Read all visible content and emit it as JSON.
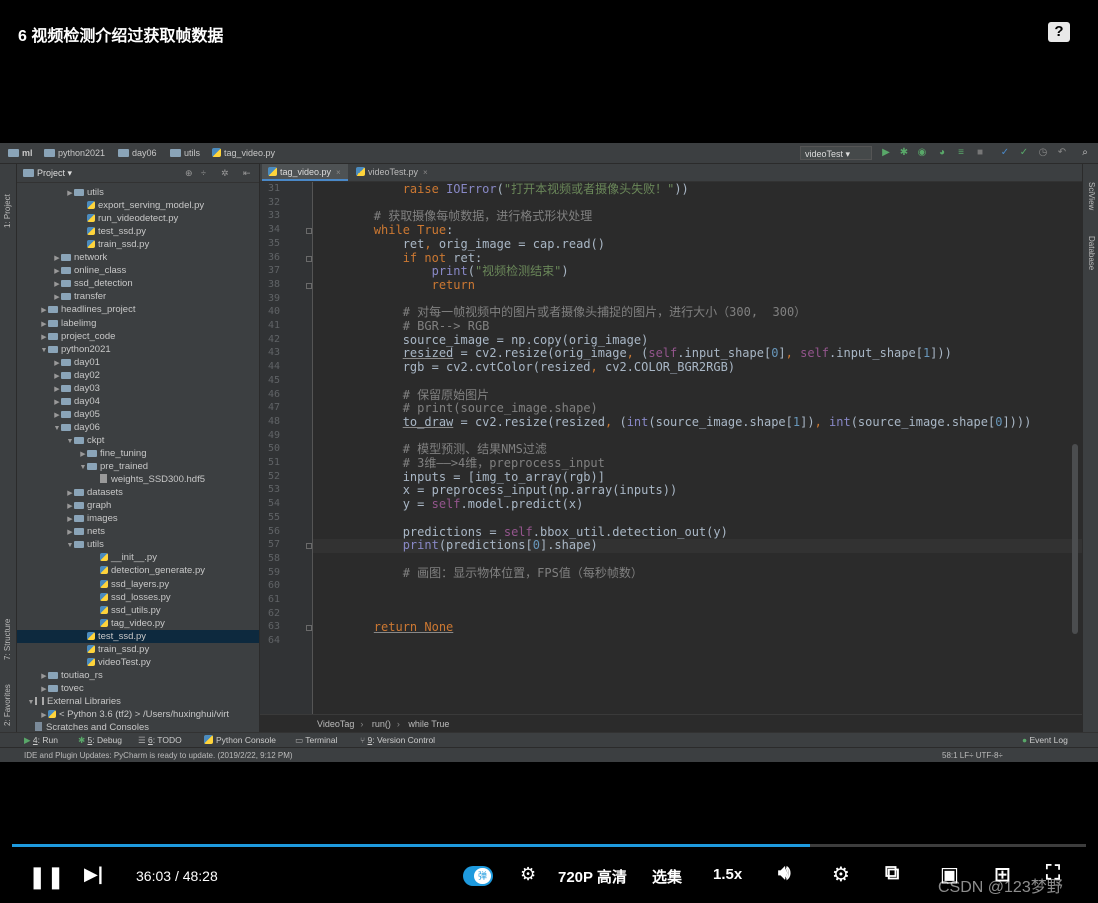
{
  "video": {
    "title": "6 视频检测介绍过获取帧数据",
    "help_icon": "?",
    "current_time": "36:03",
    "time_sep": "/",
    "total_time": "48:28",
    "progress": 0.743,
    "danmu_label": "弹",
    "quality": "720P 高清",
    "episodes": "选集",
    "speed": "1.5x",
    "watermark": "CSDN @123梦野"
  },
  "ide": {
    "breadcrumbs": [
      "ml",
      "python2021",
      "day06",
      "utils",
      "tag_video.py"
    ],
    "run_config": "videoTest",
    "left_tool_tabs": [
      "1: Project",
      "7: Structure",
      "2: Favorites"
    ],
    "right_tool_tabs": [
      "SciView",
      "Database"
    ],
    "project_header": "Project",
    "tree": [
      {
        "label": "utils",
        "type": "folder",
        "depth": 3,
        "arrow": "▶"
      },
      {
        "label": "export_serving_model.py",
        "type": "py",
        "depth": 4,
        "arrow": ""
      },
      {
        "label": "run_videodetect.py",
        "type": "py",
        "depth": 4,
        "arrow": ""
      },
      {
        "label": "test_ssd.py",
        "type": "py",
        "depth": 4,
        "arrow": ""
      },
      {
        "label": "train_ssd.py",
        "type": "py",
        "depth": 4,
        "arrow": ""
      },
      {
        "label": "network",
        "type": "folder",
        "depth": 2,
        "arrow": "▶"
      },
      {
        "label": "online_class",
        "type": "folder",
        "depth": 2,
        "arrow": "▶"
      },
      {
        "label": "ssd_detection",
        "type": "folder",
        "depth": 2,
        "arrow": "▶"
      },
      {
        "label": "transfer",
        "type": "folder",
        "depth": 2,
        "arrow": "▶"
      },
      {
        "label": "headlines_project",
        "type": "folder",
        "depth": 1,
        "arrow": "▶"
      },
      {
        "label": "labelimg",
        "type": "folder",
        "depth": 1,
        "arrow": "▶"
      },
      {
        "label": "project_code",
        "type": "folder",
        "depth": 1,
        "arrow": "▶"
      },
      {
        "label": "python2021",
        "type": "folder",
        "depth": 1,
        "arrow": "▼"
      },
      {
        "label": "day01",
        "type": "folder",
        "depth": 2,
        "arrow": "▶"
      },
      {
        "label": "day02",
        "type": "folder",
        "depth": 2,
        "arrow": "▶"
      },
      {
        "label": "day03",
        "type": "folder",
        "depth": 2,
        "arrow": "▶"
      },
      {
        "label": "day04",
        "type": "folder",
        "depth": 2,
        "arrow": "▶"
      },
      {
        "label": "day05",
        "type": "folder",
        "depth": 2,
        "arrow": "▶"
      },
      {
        "label": "day06",
        "type": "folder",
        "depth": 2,
        "arrow": "▼"
      },
      {
        "label": "ckpt",
        "type": "folder",
        "depth": 3,
        "arrow": "▼"
      },
      {
        "label": "fine_tuning",
        "type": "folder",
        "depth": 4,
        "arrow": "▶"
      },
      {
        "label": "pre_trained",
        "type": "folder",
        "depth": 4,
        "arrow": "▼"
      },
      {
        "label": "weights_SSD300.hdf5",
        "type": "file",
        "depth": 5,
        "arrow": ""
      },
      {
        "label": "datasets",
        "type": "folder",
        "depth": 3,
        "arrow": "▶"
      },
      {
        "label": "graph",
        "type": "folder",
        "depth": 3,
        "arrow": "▶"
      },
      {
        "label": "images",
        "type": "folder",
        "depth": 3,
        "arrow": "▶"
      },
      {
        "label": "nets",
        "type": "folder",
        "depth": 3,
        "arrow": "▶"
      },
      {
        "label": "utils",
        "type": "folder",
        "depth": 3,
        "arrow": "▼"
      },
      {
        "label": "__init__.py",
        "type": "py",
        "depth": 5,
        "arrow": ""
      },
      {
        "label": "detection_generate.py",
        "type": "py",
        "depth": 5,
        "arrow": ""
      },
      {
        "label": "ssd_layers.py",
        "type": "py",
        "depth": 5,
        "arrow": ""
      },
      {
        "label": "ssd_losses.py",
        "type": "py",
        "depth": 5,
        "arrow": ""
      },
      {
        "label": "ssd_utils.py",
        "type": "py",
        "depth": 5,
        "arrow": ""
      },
      {
        "label": "tag_video.py",
        "type": "py",
        "depth": 5,
        "arrow": ""
      },
      {
        "label": "test_ssd.py",
        "type": "py",
        "depth": 4,
        "arrow": "",
        "selected": true
      },
      {
        "label": "train_ssd.py",
        "type": "py",
        "depth": 4,
        "arrow": ""
      },
      {
        "label": "videoTest.py",
        "type": "py",
        "depth": 4,
        "arrow": ""
      },
      {
        "label": "toutiao_rs",
        "type": "folder",
        "depth": 1,
        "arrow": "▶"
      },
      {
        "label": "tovec",
        "type": "folder",
        "depth": 1,
        "arrow": "▶"
      },
      {
        "label": "External Libraries",
        "type": "lib",
        "depth": 0,
        "arrow": "▼"
      },
      {
        "label": "< Python 3.6 (tf2) >  /Users/huxinghui/virt",
        "type": "pyenv",
        "depth": 1,
        "arrow": "▶"
      },
      {
        "label": "Scratches and Consoles",
        "type": "scratch",
        "depth": 0,
        "arrow": ""
      }
    ],
    "tabs": [
      {
        "label": "tag_video.py",
        "active": true
      },
      {
        "label": "videoTest.py",
        "active": false
      }
    ],
    "line_numbers": [
      "31",
      "32",
      "33",
      "34",
      "35",
      "36",
      "37",
      "38",
      "39",
      "40",
      "41",
      "42",
      "43",
      "44",
      "45",
      "46",
      "47",
      "48",
      "49",
      "50",
      "51",
      "52",
      "53",
      "54",
      "55",
      "56",
      "57",
      "58",
      "59",
      "60",
      "61",
      "62",
      "63",
      "64"
    ],
    "code": [
      [
        {
          "t": "            "
        },
        {
          "t": "raise ",
          "c": "kw"
        },
        {
          "t": "IOError",
          "c": "bi"
        },
        {
          "t": "("
        },
        {
          "t": "\"打开本视频或者摄像头失败！\"",
          "c": "str"
        },
        {
          "t": "))"
        }
      ],
      [
        {
          "t": ""
        }
      ],
      [
        {
          "t": "        "
        },
        {
          "t": "# 获取摄像每帧数据，进行格式形状处理",
          "c": "cm"
        }
      ],
      [
        {
          "t": "        "
        },
        {
          "t": "while ",
          "c": "kw"
        },
        {
          "t": "True",
          "c": "kw"
        },
        {
          "t": ":"
        }
      ],
      [
        {
          "t": "            ret"
        },
        {
          "t": ", ",
          "c": "kw"
        },
        {
          "t": "orig_image = cap.read()"
        }
      ],
      [
        {
          "t": "            "
        },
        {
          "t": "if not ",
          "c": "kw"
        },
        {
          "t": "ret:"
        }
      ],
      [
        {
          "t": "                "
        },
        {
          "t": "print",
          "c": "bi"
        },
        {
          "t": "("
        },
        {
          "t": "\"视频检测结束\"",
          "c": "str"
        },
        {
          "t": ")"
        }
      ],
      [
        {
          "t": "                "
        },
        {
          "t": "return",
          "c": "kw"
        }
      ],
      [
        {
          "t": ""
        }
      ],
      [
        {
          "t": "            "
        },
        {
          "t": "# 对每一帧视频中的图片或者摄像头捕捉的图片，进行大小（300,  300）",
          "c": "cm"
        }
      ],
      [
        {
          "t": "            "
        },
        {
          "t": "# BGR--> RGB",
          "c": "cm"
        }
      ],
      [
        {
          "t": "            source_image = np.copy(orig_image)"
        }
      ],
      [
        {
          "t": "            "
        },
        {
          "t": "resized",
          "c": "ul"
        },
        {
          "t": " = cv2.resize(orig_image"
        },
        {
          "t": ", ",
          "c": "kw"
        },
        {
          "t": "("
        },
        {
          "t": "self",
          "c": "self"
        },
        {
          "t": ".input_shape["
        },
        {
          "t": "0",
          "c": "num"
        },
        {
          "t": "]"
        },
        {
          "t": ", ",
          "c": "kw"
        },
        {
          "t": "self",
          "c": "self"
        },
        {
          "t": ".input_shape["
        },
        {
          "t": "1",
          "c": "num"
        },
        {
          "t": "]))"
        }
      ],
      [
        {
          "t": "            rgb = cv2.cvtColor(resized"
        },
        {
          "t": ", ",
          "c": "kw"
        },
        {
          "t": "cv2.COLOR_BGR2RGB)"
        }
      ],
      [
        {
          "t": ""
        }
      ],
      [
        {
          "t": "            "
        },
        {
          "t": "# 保留原始图片",
          "c": "cm"
        }
      ],
      [
        {
          "t": "            "
        },
        {
          "t": "# print(source_image.shape)",
          "c": "cm"
        }
      ],
      [
        {
          "t": "            "
        },
        {
          "t": "to_draw",
          "c": "ul"
        },
        {
          "t": " = cv2.resize(resized"
        },
        {
          "t": ", ",
          "c": "kw"
        },
        {
          "t": "("
        },
        {
          "t": "int",
          "c": "bi"
        },
        {
          "t": "(source_image.shape["
        },
        {
          "t": "1",
          "c": "num"
        },
        {
          "t": "])"
        },
        {
          "t": ", ",
          "c": "kw"
        },
        {
          "t": "int",
          "c": "bi"
        },
        {
          "t": "(source_image.shape["
        },
        {
          "t": "0",
          "c": "num"
        },
        {
          "t": "])))"
        }
      ],
      [
        {
          "t": ""
        }
      ],
      [
        {
          "t": "            "
        },
        {
          "t": "# 模型预测、结果NMS过滤",
          "c": "cm"
        }
      ],
      [
        {
          "t": "            "
        },
        {
          "t": "# 3维——>4维，preprocess_input",
          "c": "cm"
        }
      ],
      [
        {
          "t": "            inputs = [img_to_array(rgb)]"
        }
      ],
      [
        {
          "t": "            x = preprocess_input(np.array(inputs))"
        }
      ],
      [
        {
          "t": "            y = "
        },
        {
          "t": "self",
          "c": "self"
        },
        {
          "t": ".model.predict(x)"
        }
      ],
      [
        {
          "t": ""
        }
      ],
      [
        {
          "t": "            predictions = "
        },
        {
          "t": "self",
          "c": "self"
        },
        {
          "t": ".bbox_util.detection_out(y)"
        }
      ],
      [
        {
          "t": "            "
        },
        {
          "t": "print",
          "c": "bi"
        },
        {
          "t": "(predictions["
        },
        {
          "t": "0",
          "c": "num"
        },
        {
          "t": "].shape)"
        }
      ],
      [
        {
          "t": ""
        }
      ],
      [
        {
          "t": "            "
        },
        {
          "t": "# 画图：显示物体位置，FPS值（每秒帧数）",
          "c": "cm"
        }
      ],
      [
        {
          "t": ""
        }
      ],
      [
        {
          "t": ""
        }
      ],
      [
        {
          "t": ""
        }
      ],
      [
        {
          "t": "        "
        },
        {
          "t": "return None",
          "c": "kw ul"
        }
      ],
      [
        {
          "t": ""
        }
      ]
    ],
    "editor_breadcrumbs": [
      "VideoTag",
      "run()",
      "while True"
    ],
    "tool_windows": [
      {
        "num": "4",
        "label": ": Run"
      },
      {
        "num": "5",
        "label": ": Debug"
      },
      {
        "num": "6",
        "label": ": TODO"
      },
      {
        "num": "",
        "label": "Python Console"
      },
      {
        "num": "",
        "label": "Terminal"
      },
      {
        "num": "9",
        "label": ": Version Control"
      }
    ],
    "event_log": "Event Log",
    "status_message": "IDE and Plugin Updates: PyCharm is ready to update. (2019/2/22, 9:12 PM)",
    "status_right": "58:1   LF÷   UTF-8÷"
  }
}
